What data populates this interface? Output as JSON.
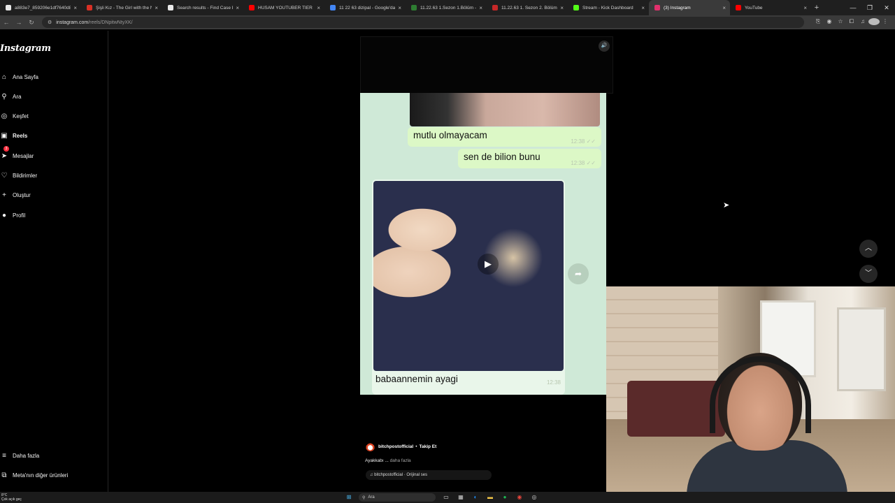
{
  "browser": {
    "tabs": [
      {
        "label": "a883e7_859206e1df7640d88d",
        "color": "#e8e8e8",
        "active": false
      },
      {
        "label": "Şişli Kız - The Girl with the Ne",
        "color": "#d93025",
        "active": false
      },
      {
        "label": "Search results - Find Case Lw",
        "color": "#e8e8e8",
        "active": false
      },
      {
        "label": "HUSAM YOUTUBER TİER LİST",
        "color": "#ff0000",
        "active": false
      },
      {
        "label": "11 22 63 dizipal - Google'da ar",
        "color": "#4285f4",
        "active": false
      },
      {
        "label": "11.22.63 1.Sezon 1.Bölüm - D",
        "color": "#2e7d32",
        "active": false
      },
      {
        "label": "11.22.63 1. Sezon 2. Bölüm izl",
        "color": "#c62828",
        "active": false
      },
      {
        "label": "Stream - Kick Dashboard",
        "color": "#53fc18",
        "active": false
      },
      {
        "label": "(3) Instagram",
        "color": "#e1306c",
        "active": true
      },
      {
        "label": "YouTube",
        "color": "#ff0000",
        "active": false
      }
    ],
    "tab_close": "×",
    "new_tab": "+",
    "url_host": "instagram.com",
    "url_path": "/reels/DNpitwNtyXK/"
  },
  "sidebar": {
    "logo": "Instagram",
    "items": [
      {
        "label": "Ana Sayfa",
        "icon": "⌂",
        "bold": false
      },
      {
        "label": "Ara",
        "icon": "⚲",
        "bold": false
      },
      {
        "label": "Keşfet",
        "icon": "◎",
        "bold": false
      },
      {
        "label": "Reels",
        "icon": "▣",
        "bold": true
      },
      {
        "label": "Mesajlar",
        "icon": "➤",
        "bold": false,
        "badge": "3"
      },
      {
        "label": "Bildirimler",
        "icon": "♡",
        "bold": false
      },
      {
        "label": "Oluştur",
        "icon": "+",
        "bold": false
      },
      {
        "label": "Profil",
        "icon": "●",
        "bold": false
      }
    ],
    "bottom_items": [
      {
        "label": "Daha fazla",
        "icon": "≡"
      },
      {
        "label": "Meta'nın diğer ürünleri",
        "icon": "⧉"
      }
    ]
  },
  "reel": {
    "sound_icon": "🔊",
    "messages": [
      {
        "text": "mutlu olmayacam",
        "time": "12:38"
      },
      {
        "text": "sen de bilion bunu",
        "time": "12:38"
      }
    ],
    "media_caption": "babaannemin ayagi",
    "media_time": "12:38",
    "play_icon": "▶",
    "share_icon": "➦",
    "author": "bitchpostofficial",
    "follow": "Takip Et",
    "description": "Ayakkabı ...",
    "more": "daha fazla",
    "audio": "♫ bitchpostofficial · Orijinal ses"
  },
  "nav": {
    "up": "︿",
    "down": "﹀"
  },
  "taskbar": {
    "weather_temp": "8°C",
    "weather_desc": "Çok açık geç",
    "search": "Ara"
  }
}
